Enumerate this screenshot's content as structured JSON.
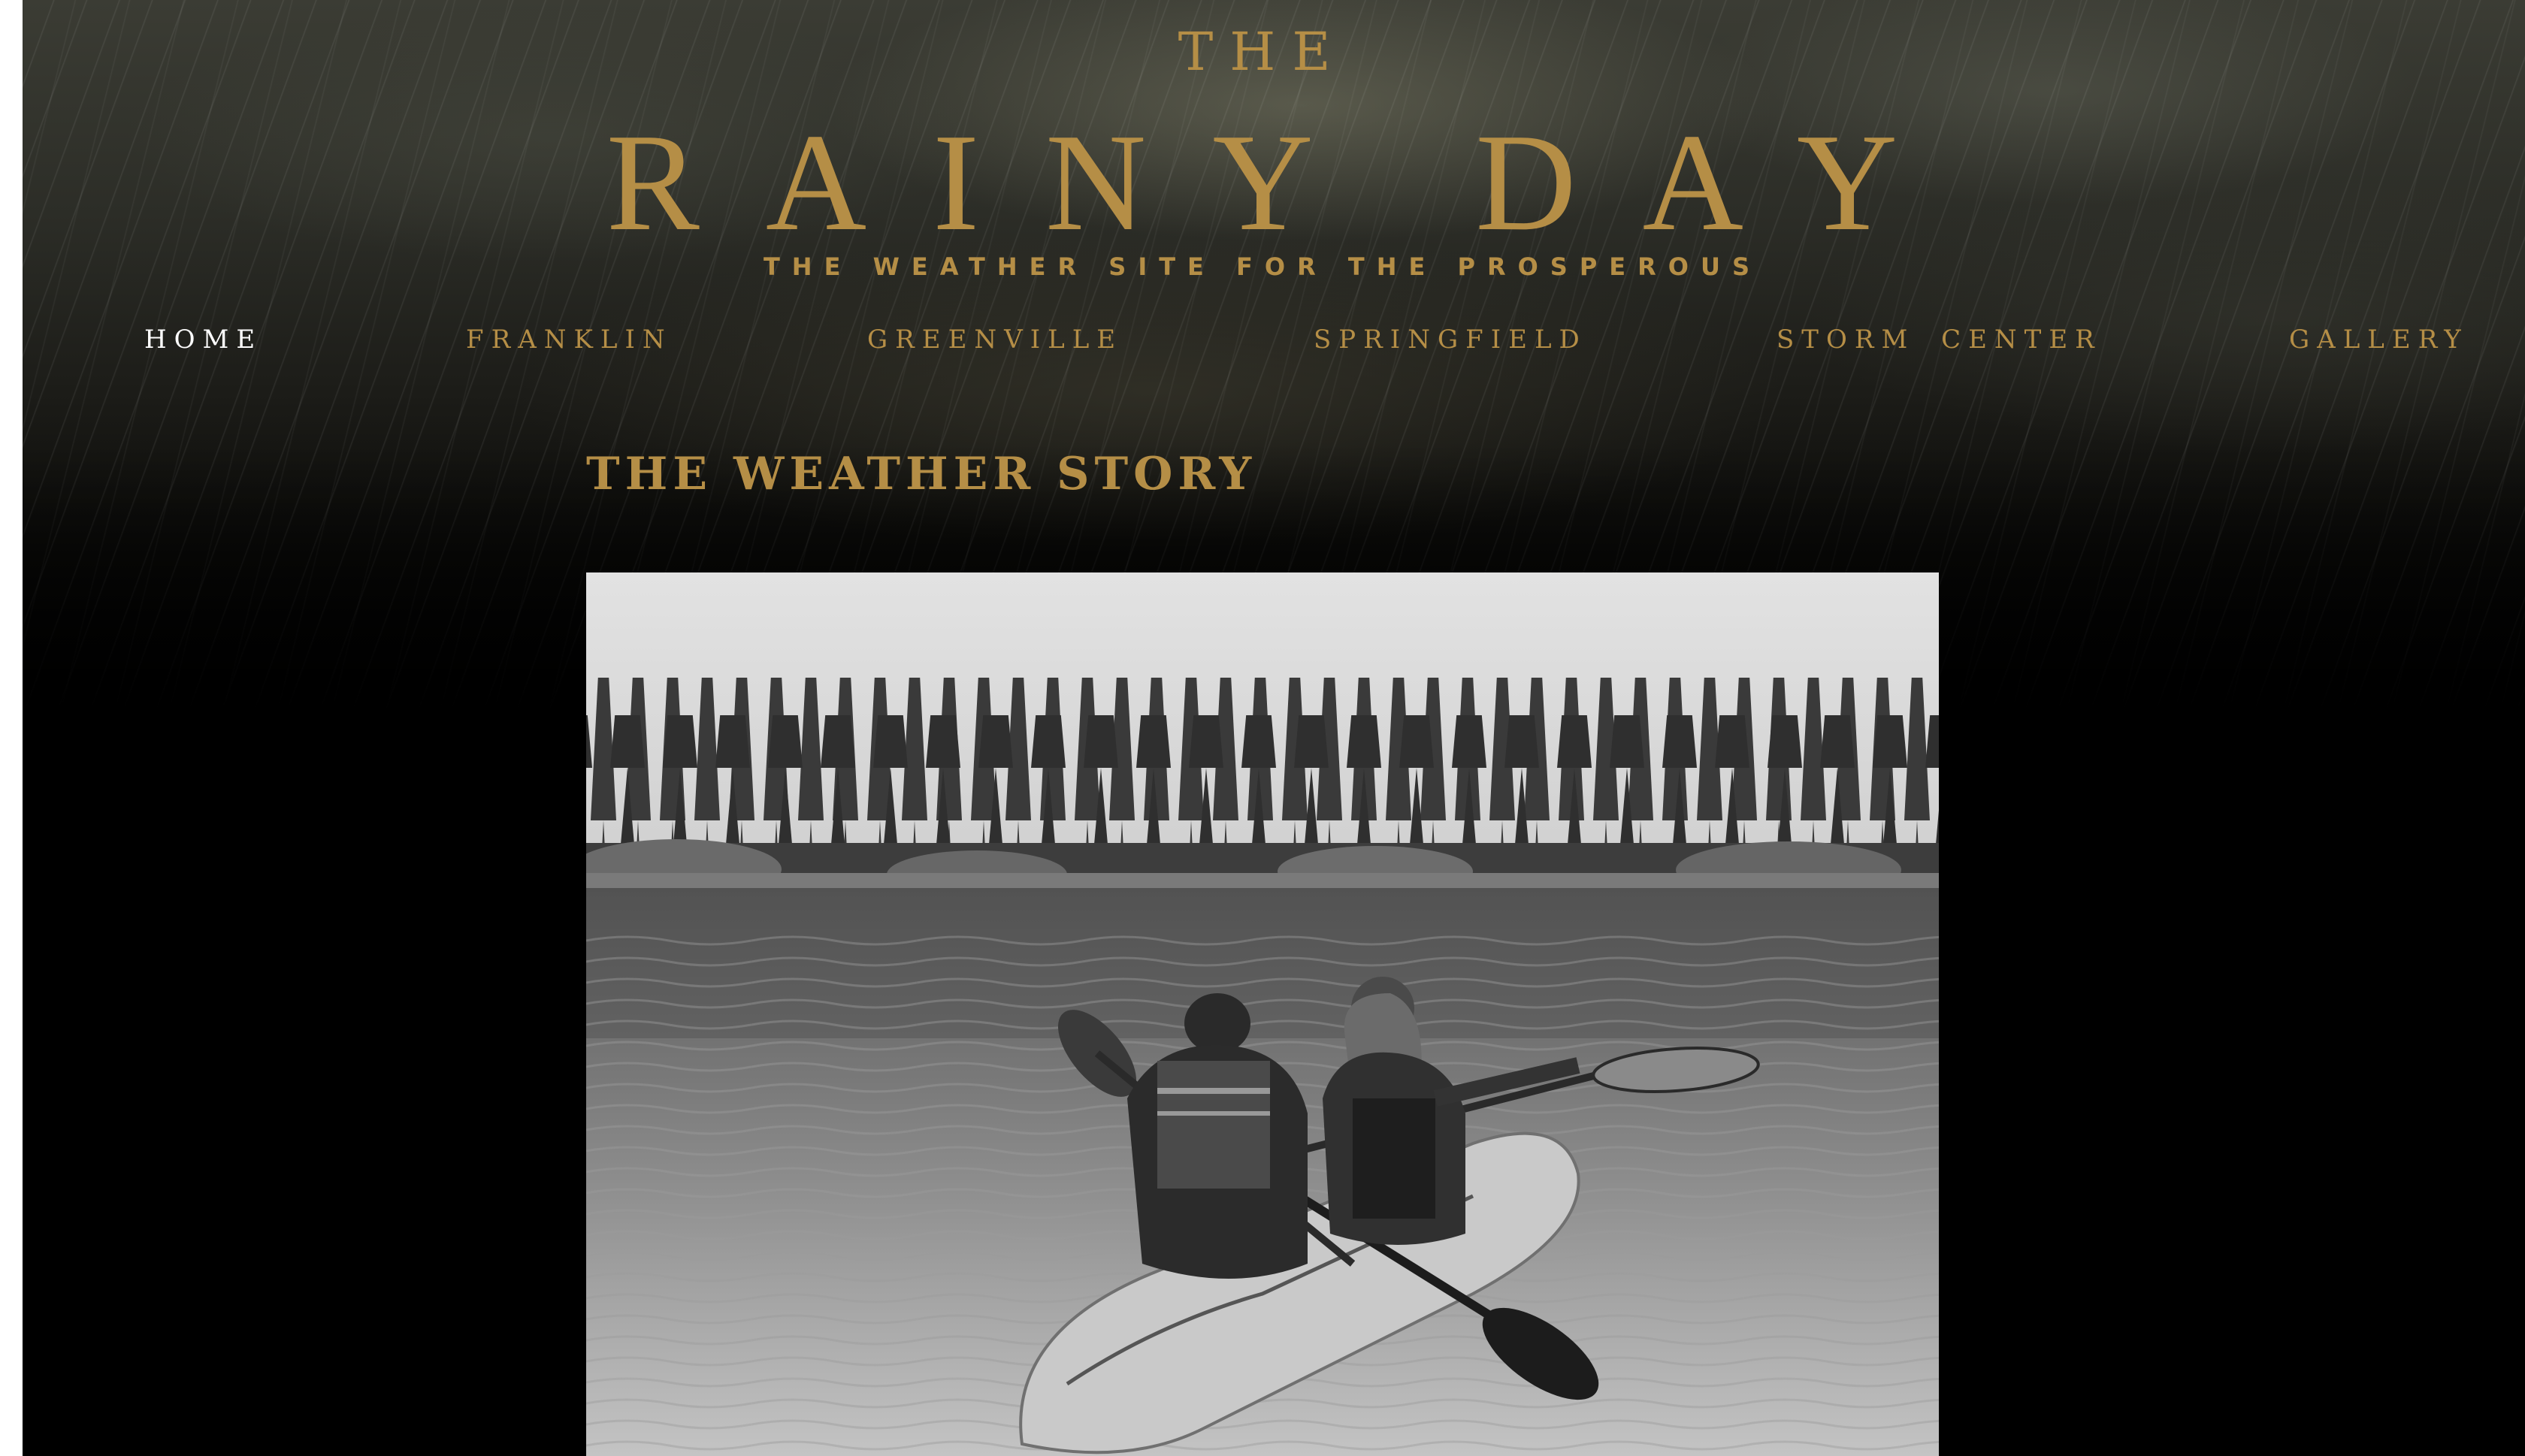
{
  "brand": {
    "the": "THE",
    "name": "RAINY DAY",
    "tagline": "THE WEATHER SITE FOR THE PROSPEROUS"
  },
  "nav": {
    "items": [
      {
        "label": "HOME",
        "active": true
      },
      {
        "label": "FRANKLIN",
        "active": false
      },
      {
        "label": "GREENVILLE",
        "active": false
      },
      {
        "label": "SPRINGFIELD",
        "active": false
      },
      {
        "label": "STORM CENTER",
        "active": false
      },
      {
        "label": "GALLERY",
        "active": false
      }
    ]
  },
  "main": {
    "section_title": "THE WEATHER STORY"
  },
  "colors": {
    "accent_gold": "#b58e46",
    "active_nav": "#ffffff",
    "background": "#000000"
  }
}
